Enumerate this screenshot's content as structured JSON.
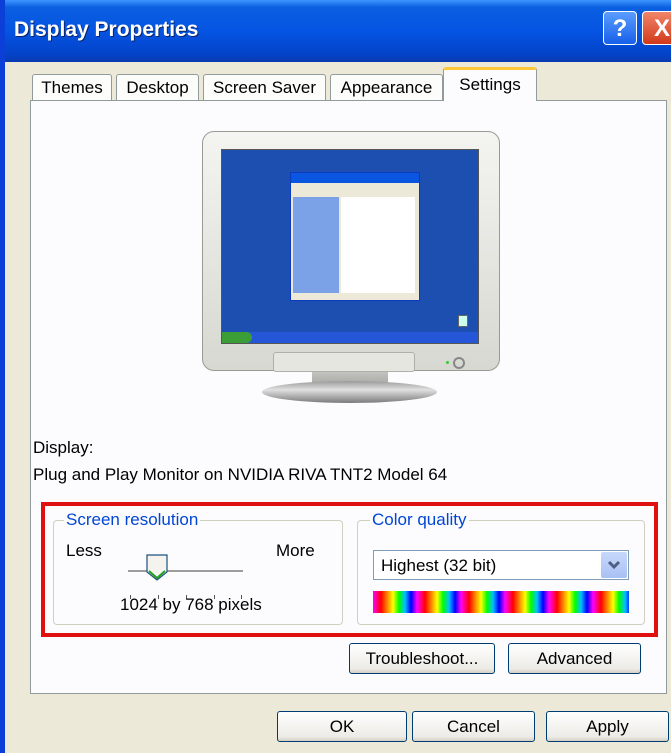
{
  "window": {
    "title": "Display Properties"
  },
  "title_buttons": {
    "help_label": "?",
    "close_label": "X"
  },
  "tabs": [
    {
      "label": "Themes",
      "active": false
    },
    {
      "label": "Desktop",
      "active": false
    },
    {
      "label": "Screen Saver",
      "active": false
    },
    {
      "label": "Appearance",
      "active": false
    },
    {
      "label": "Settings",
      "active": true
    }
  ],
  "display": {
    "label": "Display:",
    "monitor_name": "Plug and Play Monitor on NVIDIA RIVA TNT2 Model 64"
  },
  "screen_resolution": {
    "legend": "Screen resolution",
    "less_label": "Less",
    "more_label": "More",
    "value_text": "1024 by 768 pixels",
    "slider_position": 0.25
  },
  "color_quality": {
    "legend": "Color quality",
    "selected": "Highest (32 bit)"
  },
  "buttons": {
    "troubleshoot": "Troubleshoot...",
    "advanced": "Advanced",
    "ok": "OK",
    "cancel": "Cancel",
    "apply": "Apply"
  },
  "colors": {
    "titlebar": "#0554e3",
    "highlight_border": "#e01010",
    "group_legend": "#0046d5",
    "active_tab_accent": "#ffc83c"
  }
}
